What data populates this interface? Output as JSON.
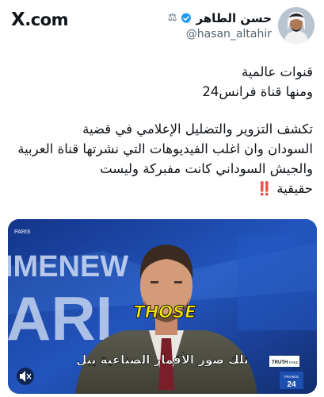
{
  "brand": {
    "logo_text": "X",
    "domain": ".com"
  },
  "author": {
    "display_name": "حسن الطاهر",
    "handle": "@hasan_altahir",
    "affiliation_icon": "scales-icon",
    "verified_icon": "verified-badge-icon",
    "verified_color": "#1d9bf0"
  },
  "tweet": {
    "lines_block1": [
      "قنوات عالمية",
      "ومنها قناة فرانس24"
    ],
    "lines_block2": [
      "تكشف التزوير  والتضليل الإعلامي  في قضية",
      "السودان وان اغلب الفيديوهات التي نشرتها قناة العربية",
      "والجيش السوداني  كانت مفبركة وليست",
      "حقيقية"
    ],
    "emphasis_emoji": "‼️",
    "emphasis_color": "#e0245e"
  },
  "media": {
    "corner_label": "PARIS",
    "backdrop_text": "IMENEW",
    "backdrop_text2": "ARI",
    "caption_word": "THOSE",
    "subtitle": "تلك صور الأقمار الصناعية يبل",
    "truth_label": "TRUTH",
    "fake_label": "FAKE",
    "channel_name": "FRANCE",
    "channel_number": "24",
    "mute_icon": "speaker-muted-icon",
    "accent_blue": "#1a3a8e",
    "caption_yellow": "#f5e400"
  }
}
